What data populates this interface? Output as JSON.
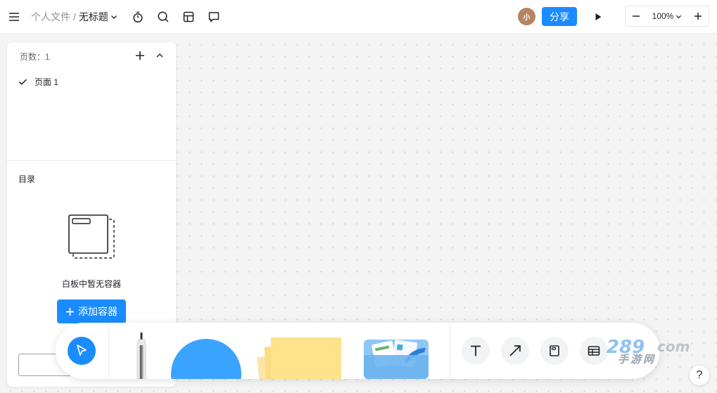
{
  "header": {
    "breadcrumb_parent": "个人文件",
    "breadcrumb_sep": "/",
    "doc_title": "无标题",
    "avatar_text": "小",
    "share_label": "分享",
    "zoom_level": "100%"
  },
  "panel": {
    "pages_header": "页数：1",
    "pages": [
      {
        "label": "页面 1",
        "selected": true
      }
    ],
    "toc_title": "目录",
    "empty_text": "白板中暂无容器",
    "add_container_label": "添加容器"
  },
  "toolbar": {
    "tools": [
      "select-tool",
      "pen-tool",
      "shape-tool",
      "sticky-note-tool",
      "media-tool",
      "text-tool",
      "connector-tool",
      "container-tool",
      "table-tool"
    ]
  },
  "watermark": {
    "text": "手游网"
  },
  "help": {
    "label": "?"
  },
  "colors": {
    "accent": "#1a8cff",
    "canvas": "#f4f4f4",
    "avatar": "#b58463",
    "sticky": "#fde38a",
    "shape": "#3aa3ff"
  }
}
